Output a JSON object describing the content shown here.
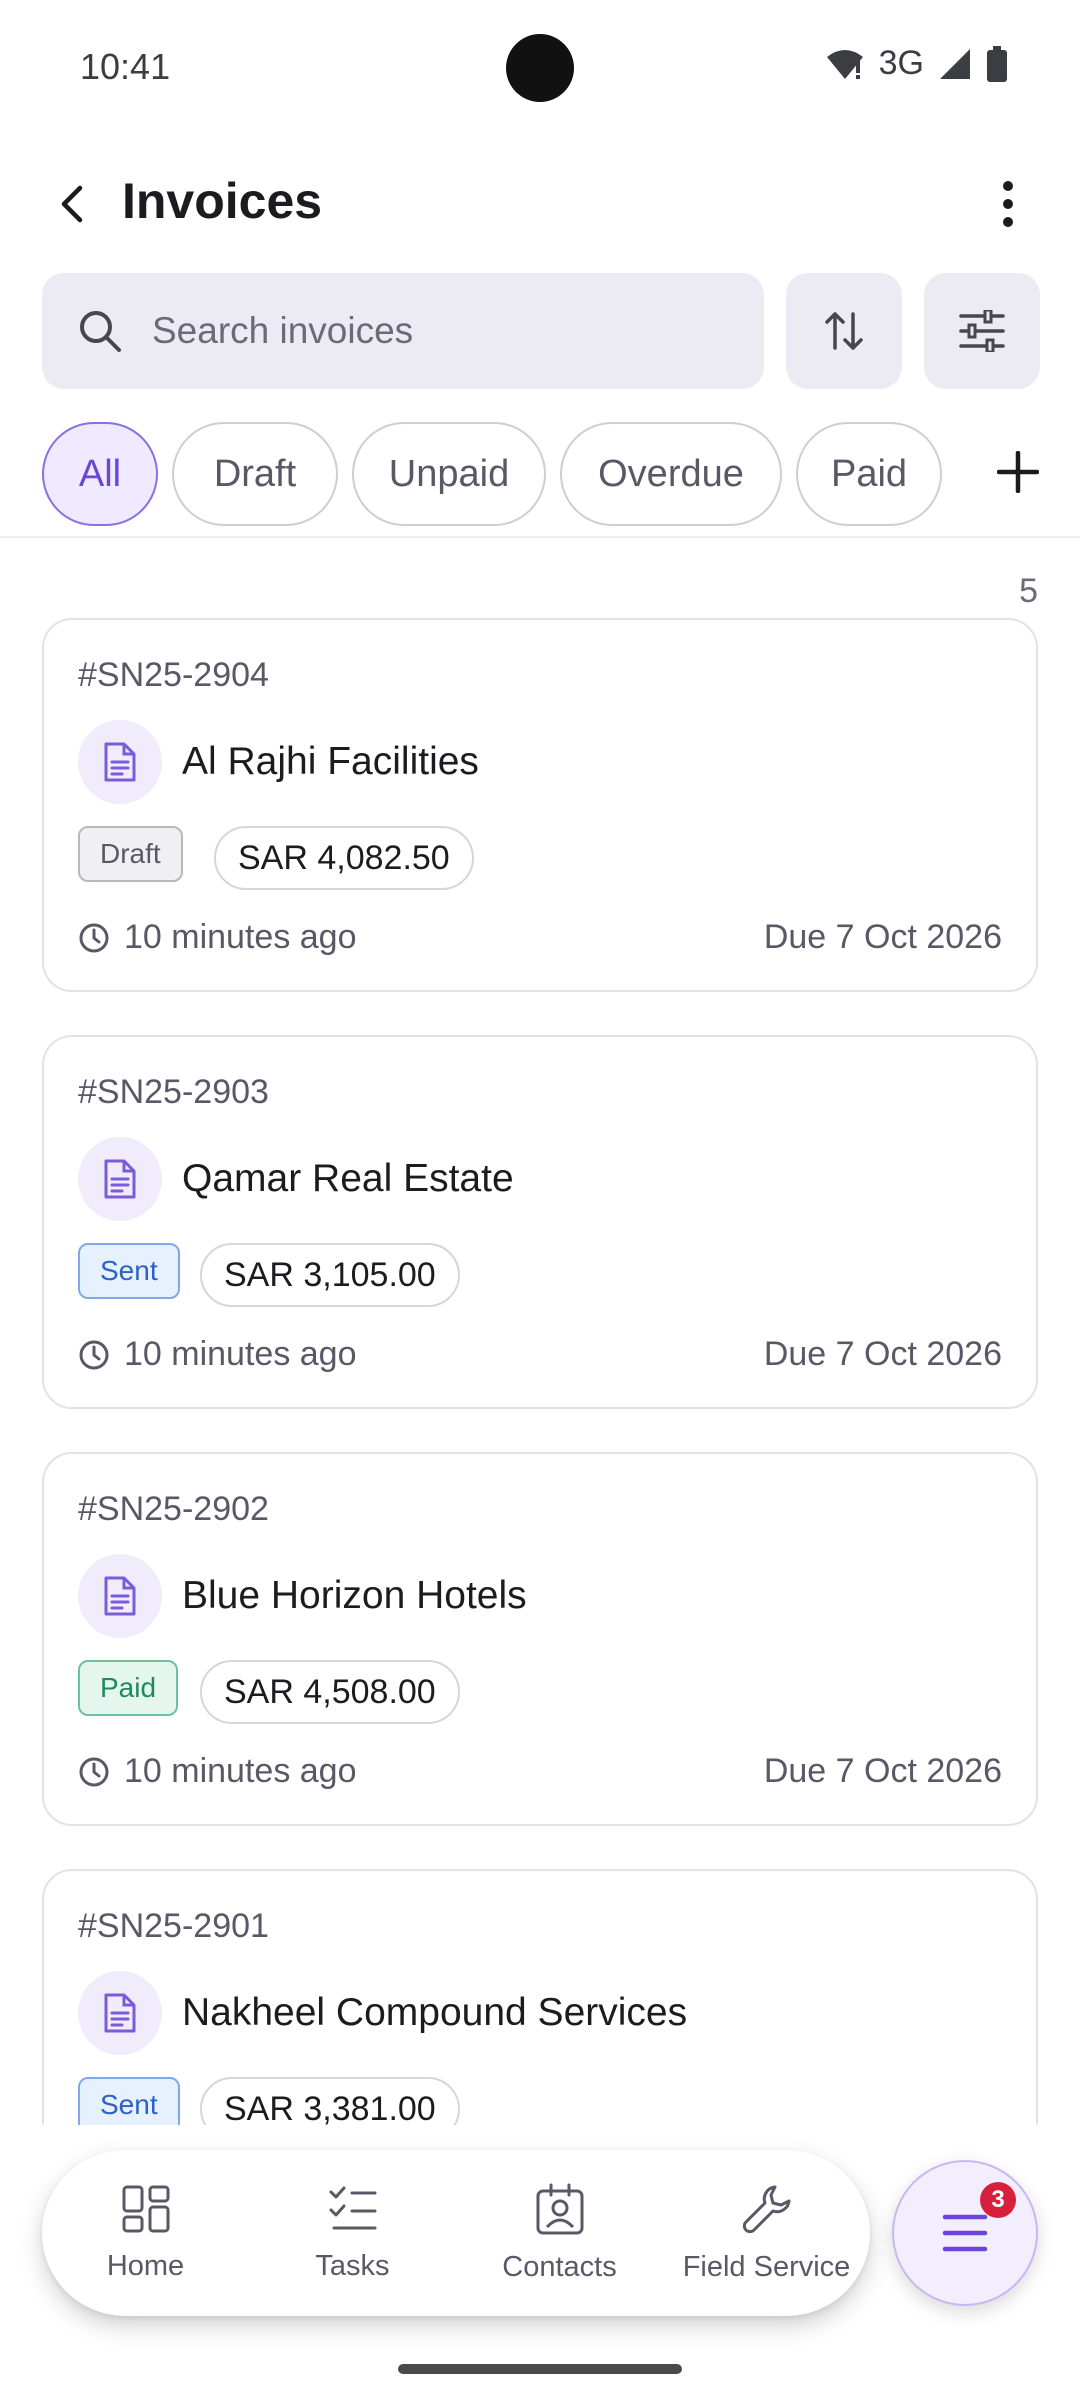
{
  "status_bar": {
    "time": "10:41",
    "network": "3G"
  },
  "header": {
    "title": "Invoices"
  },
  "search": {
    "placeholder": "Search invoices"
  },
  "filters": [
    {
      "label": "All",
      "active": true
    },
    {
      "label": "Draft",
      "active": false
    },
    {
      "label": "Unpaid",
      "active": false
    },
    {
      "label": "Overdue",
      "active": false
    },
    {
      "label": "Paid",
      "active": false
    }
  ],
  "list": {
    "count": "5",
    "invoices": [
      {
        "number": "#SN25-2904",
        "client": "Al Rajhi Facilities",
        "status": "Draft",
        "amount": "SAR 4,082.50",
        "time": "10 minutes ago",
        "due": "Due 7 Oct 2026"
      },
      {
        "number": "#SN25-2903",
        "client": "Qamar Real Estate",
        "status": "Sent",
        "amount": "SAR 3,105.00",
        "time": "10 minutes ago",
        "due": "Due 7 Oct 2026"
      },
      {
        "number": "#SN25-2902",
        "client": "Blue Horizon Hotels",
        "status": "Paid",
        "amount": "SAR 4,508.00",
        "time": "10 minutes ago",
        "due": "Due 7 Oct 2026"
      },
      {
        "number": "#SN25-2901",
        "client": "Nakheel Compound Services",
        "status": "Sent",
        "amount": "SAR 3,381.00",
        "time": "",
        "due": ""
      }
    ]
  },
  "bottom_nav": [
    {
      "label": "Home",
      "icon": "grid-icon"
    },
    {
      "label": "Tasks",
      "icon": "checklist-icon"
    },
    {
      "label": "Contacts",
      "icon": "contact-badge-icon"
    },
    {
      "label": "Field Service",
      "icon": "wrench-icon"
    }
  ],
  "fab": {
    "badge": "3"
  },
  "colors": {
    "accent": "#6b45d6",
    "accent_bg": "#efeaff",
    "draft": "#5a5866",
    "sent": "#2c62c4",
    "paid": "#1f8a5b",
    "badge": "#d8203d"
  }
}
